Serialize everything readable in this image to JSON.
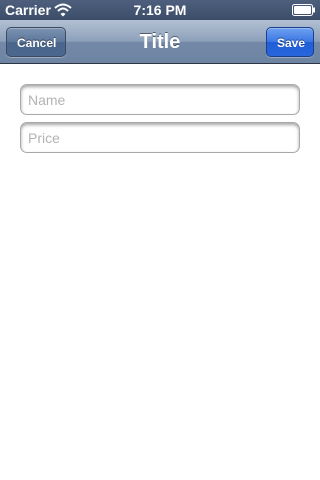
{
  "status_bar": {
    "carrier": "Carrier",
    "time": "7:16 PM",
    "wifi_icon": "wifi-icon",
    "battery_icon": "battery-icon"
  },
  "nav_bar": {
    "title": "Title",
    "left_button": "Cancel",
    "right_button": "Save"
  },
  "form": {
    "name_field": {
      "value": "",
      "placeholder": "Name"
    },
    "price_field": {
      "value": "",
      "placeholder": "Price"
    }
  },
  "colors": {
    "nav_background": "#8da0ba",
    "save_button": "#2f6edf",
    "cancel_button": "#4a668c"
  }
}
